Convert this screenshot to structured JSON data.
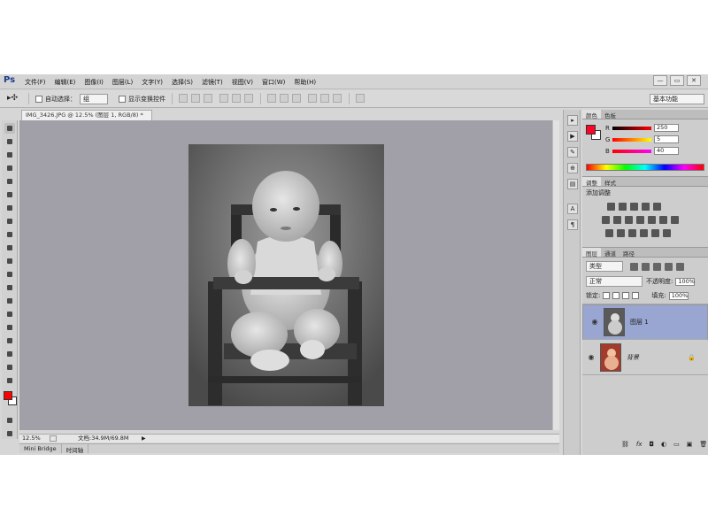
{
  "app": {
    "logo": "Ps",
    "menus": [
      "文件(F)",
      "编辑(E)",
      "图像(I)",
      "图层(L)",
      "文字(Y)",
      "选择(S)",
      "滤镜(T)",
      "视图(V)",
      "窗口(W)",
      "帮助(H)"
    ],
    "window_buttons": [
      "—",
      "▭",
      "✕"
    ]
  },
  "options_bar": {
    "auto_select_label": "自动选择：",
    "auto_select_value": "组",
    "show_transform_label": "显示变换控件",
    "workspace": "基本功能"
  },
  "document": {
    "tab_title": "IMG_3426.JPG @ 12.5% (图层 1, RGB/8) *",
    "zoom": "12.5%",
    "doc_info": "文档:34.9M/69.8M"
  },
  "bottom_tabs": [
    "Mini Bridge",
    "时间轴"
  ],
  "color_panel": {
    "tabs": [
      "颜色",
      "色板"
    ],
    "channels": [
      {
        "label": "R",
        "value": "250"
      },
      {
        "label": "G",
        "value": "5"
      },
      {
        "label": "B",
        "value": "40"
      }
    ],
    "foreground_color": "#fa0528"
  },
  "adjustments_panel": {
    "tabs": [
      "调整",
      "样式"
    ],
    "title": "添加调整"
  },
  "layers_panel": {
    "tabs": [
      "图层",
      "通道",
      "路径"
    ],
    "filter_kind": "类型",
    "blend_mode": "正常",
    "opacity_label": "不透明度:",
    "opacity_value": "100%",
    "lock_label": "锁定:",
    "fill_label": "填充:",
    "fill_value": "100%",
    "layers": [
      {
        "name": "图层 1",
        "selected": true
      },
      {
        "name": "背景",
        "selected": false
      }
    ]
  },
  "colors": {
    "canvas_bg": "#a1a0a8",
    "selected_layer": "#98a6d1",
    "fg": "#ff0000",
    "bg": "#ffffff"
  }
}
